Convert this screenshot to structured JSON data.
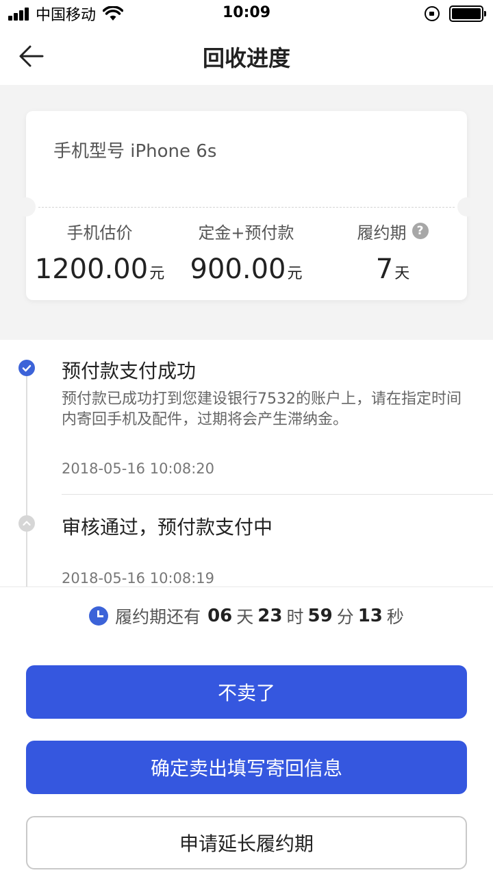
{
  "status_bar": {
    "carrier": "中国移动",
    "time": "10:09"
  },
  "nav": {
    "title": "回收进度"
  },
  "card": {
    "model": "手机型号 iPhone 6s",
    "stats": [
      {
        "label": "手机估价",
        "value": "1200.00",
        "unit": "元"
      },
      {
        "label": "定金+预付款",
        "value": "900.00",
        "unit": "元"
      },
      {
        "label": "履约期",
        "value": "7",
        "unit": "天"
      }
    ],
    "help_symbol": "?"
  },
  "timeline": [
    {
      "title": "预付款支付成功",
      "description": "预付款已成功打到您建设银行7532的账户上，请在指定时间内寄回手机及配件，过期将会产生滞纳金。",
      "time": "2018-05-16 10:08:20",
      "status": "active"
    },
    {
      "title": "审核通过，预付款支付中",
      "time": "2018-05-16 10:08:19",
      "status": "done"
    }
  ],
  "countdown": {
    "prefix": "履约期还有",
    "days": "06",
    "days_unit": "天",
    "hours": "23",
    "hours_unit": "时",
    "minutes": "59",
    "minutes_unit": "分",
    "seconds": "13",
    "seconds_unit": "秒"
  },
  "buttons": {
    "cancel": "不卖了",
    "confirm": "确定卖出填写寄回信息",
    "extend": "申请延长履约期"
  },
  "colors": {
    "accent": "#3557df",
    "timeline_active": "#3c63d8",
    "background_gray": "#f3f3f3"
  }
}
